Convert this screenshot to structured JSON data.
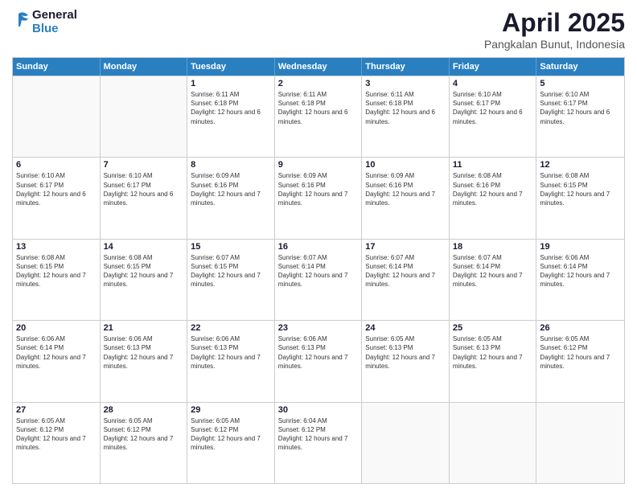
{
  "logo": {
    "line1": "General",
    "line2": "Blue"
  },
  "title": "April 2025",
  "subtitle": "Pangkalan Bunut, Indonesia",
  "header_days": [
    "Sunday",
    "Monday",
    "Tuesday",
    "Wednesday",
    "Thursday",
    "Friday",
    "Saturday"
  ],
  "weeks": [
    [
      {
        "day": "",
        "empty": true
      },
      {
        "day": "",
        "empty": true
      },
      {
        "day": "1",
        "sunrise": "Sunrise: 6:11 AM",
        "sunset": "Sunset: 6:18 PM",
        "daylight": "Daylight: 12 hours and 6 minutes."
      },
      {
        "day": "2",
        "sunrise": "Sunrise: 6:11 AM",
        "sunset": "Sunset: 6:18 PM",
        "daylight": "Daylight: 12 hours and 6 minutes."
      },
      {
        "day": "3",
        "sunrise": "Sunrise: 6:11 AM",
        "sunset": "Sunset: 6:18 PM",
        "daylight": "Daylight: 12 hours and 6 minutes."
      },
      {
        "day": "4",
        "sunrise": "Sunrise: 6:10 AM",
        "sunset": "Sunset: 6:17 PM",
        "daylight": "Daylight: 12 hours and 6 minutes."
      },
      {
        "day": "5",
        "sunrise": "Sunrise: 6:10 AM",
        "sunset": "Sunset: 6:17 PM",
        "daylight": "Daylight: 12 hours and 6 minutes."
      }
    ],
    [
      {
        "day": "6",
        "sunrise": "Sunrise: 6:10 AM",
        "sunset": "Sunset: 6:17 PM",
        "daylight": "Daylight: 12 hours and 6 minutes."
      },
      {
        "day": "7",
        "sunrise": "Sunrise: 6:10 AM",
        "sunset": "Sunset: 6:17 PM",
        "daylight": "Daylight: 12 hours and 6 minutes."
      },
      {
        "day": "8",
        "sunrise": "Sunrise: 6:09 AM",
        "sunset": "Sunset: 6:16 PM",
        "daylight": "Daylight: 12 hours and 7 minutes."
      },
      {
        "day": "9",
        "sunrise": "Sunrise: 6:09 AM",
        "sunset": "Sunset: 6:16 PM",
        "daylight": "Daylight: 12 hours and 7 minutes."
      },
      {
        "day": "10",
        "sunrise": "Sunrise: 6:09 AM",
        "sunset": "Sunset: 6:16 PM",
        "daylight": "Daylight: 12 hours and 7 minutes."
      },
      {
        "day": "11",
        "sunrise": "Sunrise: 6:08 AM",
        "sunset": "Sunset: 6:16 PM",
        "daylight": "Daylight: 12 hours and 7 minutes."
      },
      {
        "day": "12",
        "sunrise": "Sunrise: 6:08 AM",
        "sunset": "Sunset: 6:15 PM",
        "daylight": "Daylight: 12 hours and 7 minutes."
      }
    ],
    [
      {
        "day": "13",
        "sunrise": "Sunrise: 6:08 AM",
        "sunset": "Sunset: 6:15 PM",
        "daylight": "Daylight: 12 hours and 7 minutes."
      },
      {
        "day": "14",
        "sunrise": "Sunrise: 6:08 AM",
        "sunset": "Sunset: 6:15 PM",
        "daylight": "Daylight: 12 hours and 7 minutes."
      },
      {
        "day": "15",
        "sunrise": "Sunrise: 6:07 AM",
        "sunset": "Sunset: 6:15 PM",
        "daylight": "Daylight: 12 hours and 7 minutes."
      },
      {
        "day": "16",
        "sunrise": "Sunrise: 6:07 AM",
        "sunset": "Sunset: 6:14 PM",
        "daylight": "Daylight: 12 hours and 7 minutes."
      },
      {
        "day": "17",
        "sunrise": "Sunrise: 6:07 AM",
        "sunset": "Sunset: 6:14 PM",
        "daylight": "Daylight: 12 hours and 7 minutes."
      },
      {
        "day": "18",
        "sunrise": "Sunrise: 6:07 AM",
        "sunset": "Sunset: 6:14 PM",
        "daylight": "Daylight: 12 hours and 7 minutes."
      },
      {
        "day": "19",
        "sunrise": "Sunrise: 6:06 AM",
        "sunset": "Sunset: 6:14 PM",
        "daylight": "Daylight: 12 hours and 7 minutes."
      }
    ],
    [
      {
        "day": "20",
        "sunrise": "Sunrise: 6:06 AM",
        "sunset": "Sunset: 6:14 PM",
        "daylight": "Daylight: 12 hours and 7 minutes."
      },
      {
        "day": "21",
        "sunrise": "Sunrise: 6:06 AM",
        "sunset": "Sunset: 6:13 PM",
        "daylight": "Daylight: 12 hours and 7 minutes."
      },
      {
        "day": "22",
        "sunrise": "Sunrise: 6:06 AM",
        "sunset": "Sunset: 6:13 PM",
        "daylight": "Daylight: 12 hours and 7 minutes."
      },
      {
        "day": "23",
        "sunrise": "Sunrise: 6:06 AM",
        "sunset": "Sunset: 6:13 PM",
        "daylight": "Daylight: 12 hours and 7 minutes."
      },
      {
        "day": "24",
        "sunrise": "Sunrise: 6:05 AM",
        "sunset": "Sunset: 6:13 PM",
        "daylight": "Daylight: 12 hours and 7 minutes."
      },
      {
        "day": "25",
        "sunrise": "Sunrise: 6:05 AM",
        "sunset": "Sunset: 6:13 PM",
        "daylight": "Daylight: 12 hours and 7 minutes."
      },
      {
        "day": "26",
        "sunrise": "Sunrise: 6:05 AM",
        "sunset": "Sunset: 6:12 PM",
        "daylight": "Daylight: 12 hours and 7 minutes."
      }
    ],
    [
      {
        "day": "27",
        "sunrise": "Sunrise: 6:05 AM",
        "sunset": "Sunset: 6:12 PM",
        "daylight": "Daylight: 12 hours and 7 minutes."
      },
      {
        "day": "28",
        "sunrise": "Sunrise: 6:05 AM",
        "sunset": "Sunset: 6:12 PM",
        "daylight": "Daylight: 12 hours and 7 minutes."
      },
      {
        "day": "29",
        "sunrise": "Sunrise: 6:05 AM",
        "sunset": "Sunset: 6:12 PM",
        "daylight": "Daylight: 12 hours and 7 minutes."
      },
      {
        "day": "30",
        "sunrise": "Sunrise: 6:04 AM",
        "sunset": "Sunset: 6:12 PM",
        "daylight": "Daylight: 12 hours and 7 minutes."
      },
      {
        "day": "",
        "empty": true
      },
      {
        "day": "",
        "empty": true
      },
      {
        "day": "",
        "empty": true
      }
    ]
  ]
}
